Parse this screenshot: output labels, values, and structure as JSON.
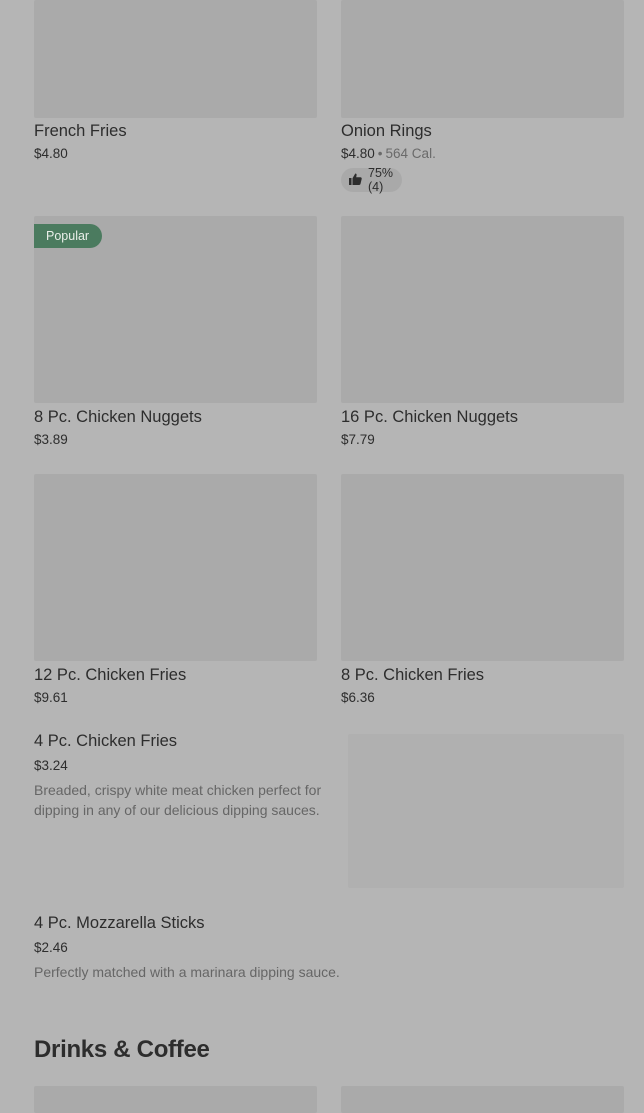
{
  "grid_items": [
    {
      "name": "French Fries",
      "price": "$4.80"
    },
    {
      "name": "Onion Rings",
      "price": "$4.80",
      "calories": "564 Cal.",
      "rating": "75% (4)"
    },
    {
      "name": "8 Pc. Chicken Nuggets",
      "price": "$3.89",
      "badge": "Popular"
    },
    {
      "name": "16 Pc. Chicken Nuggets",
      "price": "$7.79"
    },
    {
      "name": "12 Pc. Chicken Fries",
      "price": "$9.61"
    },
    {
      "name": "8 Pc. Chicken Fries",
      "price": "$6.36"
    }
  ],
  "list_items": [
    {
      "name": "4 Pc. Chicken Fries",
      "price": "$3.24",
      "description": "Breaded, crispy white meat chicken perfect for dipping in any of our delicious dipping sauces."
    },
    {
      "name": "4 Pc. Mozzarella Sticks",
      "price": "$2.46",
      "description": "Perfectly matched with a marinara dipping sauce."
    }
  ],
  "sections": {
    "drinks_title": "Drinks & Coffee"
  },
  "colors": {
    "background": "#b5b5b5",
    "badge": "#4b7b5f"
  }
}
